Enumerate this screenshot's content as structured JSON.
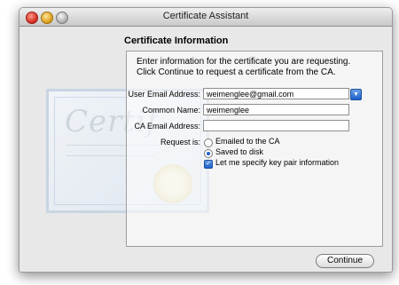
{
  "window": {
    "title": "Certificate Assistant"
  },
  "section": {
    "title": "Certificate Information"
  },
  "intro": {
    "line1": "Enter information for the certificate you are requesting.",
    "line2": "Click Continue to request a certificate from the CA."
  },
  "art": {
    "cert_word": "Certif"
  },
  "form": {
    "user_email_label": "User Email Address:",
    "user_email_value": "weimenglee@gmail.com",
    "common_name_label": "Common Name:",
    "common_name_value": "weimenglee",
    "ca_email_label": "CA Email Address:",
    "ca_email_value": "",
    "request_label": "Request is:",
    "option_emailed": "Emailed to the CA",
    "option_saved": "Saved to disk",
    "option_keypair": "Let me specify key pair information",
    "selected_request": "Saved to disk",
    "keypair_checked": true
  },
  "buttons": {
    "continue": "Continue"
  },
  "icons": {
    "close": "close-icon",
    "minimize": "minimize-icon",
    "zoom": "zoom-icon",
    "combo": "chevron-down-icon",
    "check": "checkmark-icon"
  },
  "colors": {
    "accent": "#1b5fc9",
    "window_bg": "#e8e8e8"
  }
}
